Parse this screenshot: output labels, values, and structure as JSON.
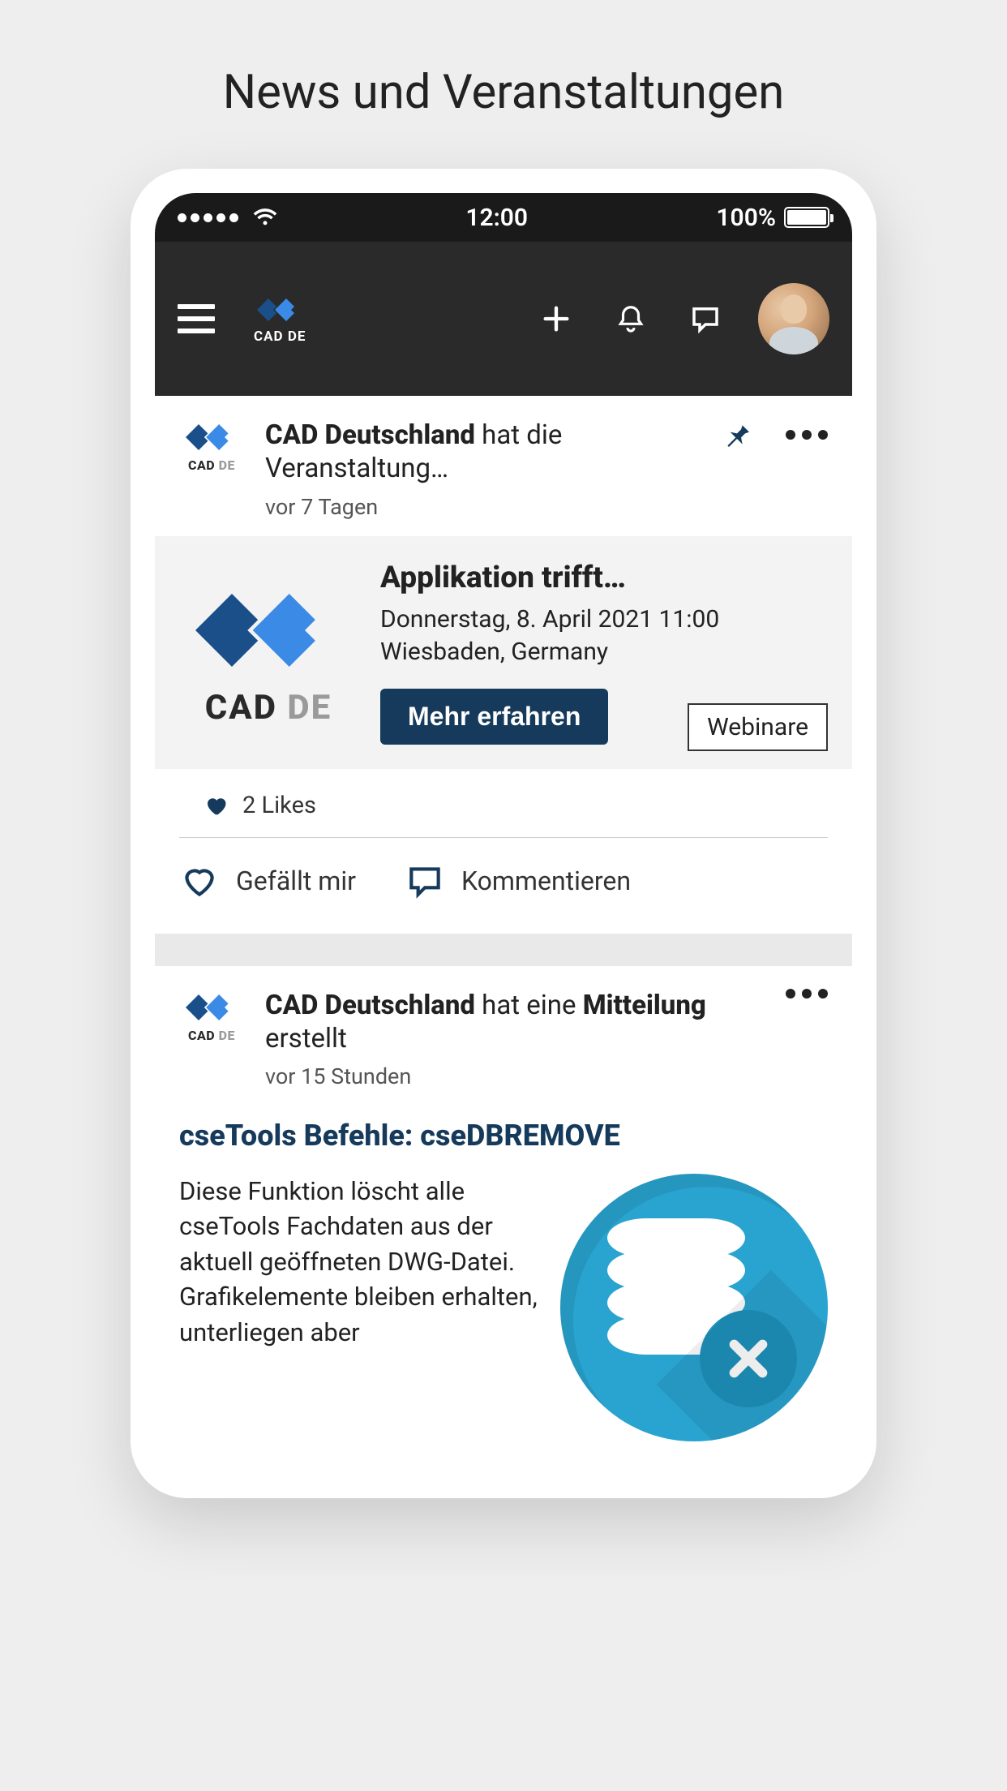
{
  "page": {
    "title": "News und Veranstaltungen"
  },
  "status": {
    "time": "12:00",
    "battery": "100%"
  },
  "header": {
    "brand": "CAD DE"
  },
  "feed": {
    "post1": {
      "author": "CAD Deutschland",
      "verb": " hat die Veranstaltung…",
      "time": "vor 7 Tagen",
      "event": {
        "title": "Applikation trifft…",
        "datetime": "Donnerstag, 8. April 2021 11:00",
        "location": "Wiesbaden, Germany",
        "cta": "Mehr erfahren",
        "tag": "Webinare",
        "brand_big": "CAD",
        "brand_big_de": " DE"
      },
      "likes": "2 Likes",
      "like_label": "Gefällt mir",
      "comment_label": "Kommentieren"
    },
    "post2": {
      "author": "CAD Deutschland",
      "verb_pre": " hat eine ",
      "verb_bold": "Mitteilung",
      "verb_post": " erstellt",
      "time": "vor 15 Stunden",
      "title": "cseTools Befehle: cseDBREMOVE",
      "body": "Diese Funktion löscht alle cseTools Fachdaten aus der aktuell geöffneten DWG-Datei. Grafikelemente bleiben erhalten, unterliegen aber"
    }
  }
}
